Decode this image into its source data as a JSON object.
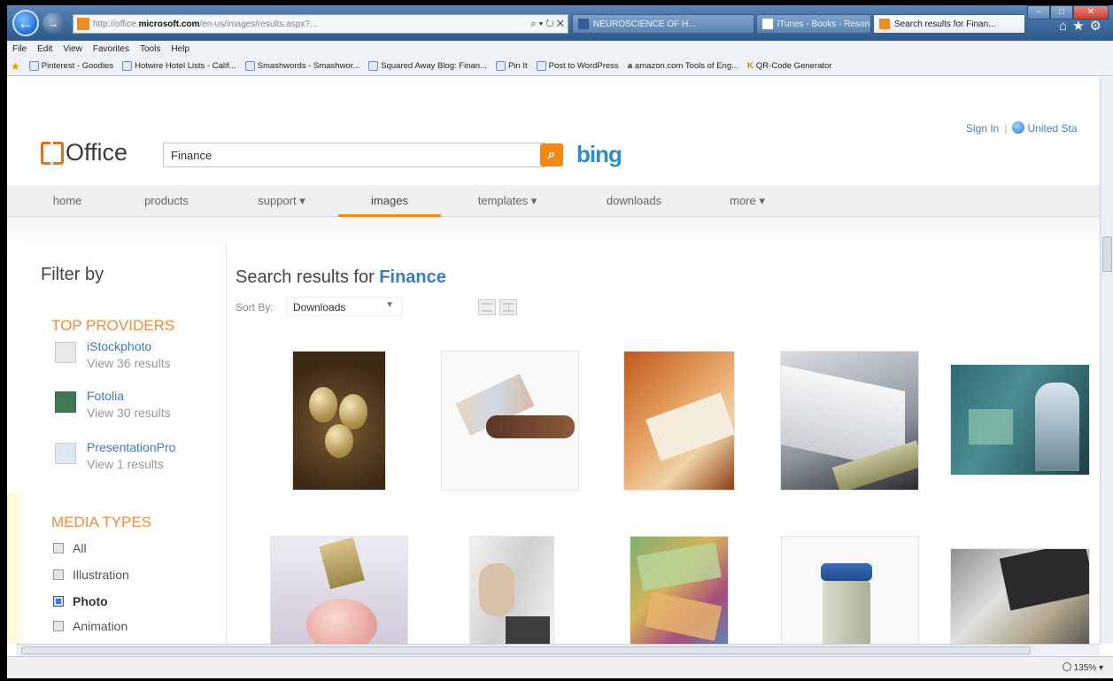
{
  "browser": {
    "address_host": "microsoft.com",
    "tabs": [
      {
        "label": "NEUROSCIENCE OF H..."
      },
      {
        "label": "iTunes - Books - Resonate..."
      },
      {
        "label": "Search results for Finan..."
      }
    ],
    "menu": [
      "File",
      "Edit",
      "View",
      "Favorites",
      "Tools",
      "Help"
    ],
    "favorites": [
      "Pinterest - Goodies",
      "Hotwire Hotel Lists - Calif...",
      "Smashwords - Smashwor...",
      "Squared Away Blog: Finan...",
      "Pin It",
      "Post to WordPress",
      "amazon.com Tools of Eng...",
      "QR-Code Generator"
    ],
    "zoom": "135%"
  },
  "header": {
    "logo": "Office",
    "search_value": "Finance",
    "bing": "bing",
    "sign_in": "Sign In",
    "region": "United Sta"
  },
  "nav": [
    {
      "label": "home"
    },
    {
      "label": "products"
    },
    {
      "label": "support ▾"
    },
    {
      "label": "images"
    },
    {
      "label": "templates ▾"
    },
    {
      "label": "downloads"
    },
    {
      "label": "more ▾"
    }
  ],
  "sidebar": {
    "title": "Filter by",
    "providers_title": "TOP PROVIDERS",
    "providers": [
      {
        "name": "iStockphoto",
        "count": "View 36 results"
      },
      {
        "name": "Fotolia",
        "count": "View 30 results"
      },
      {
        "name": "PresentationPro",
        "count": "View 1 results"
      }
    ],
    "media_title": "MEDIA TYPES",
    "media_types": [
      {
        "label": "All",
        "checked": false
      },
      {
        "label": "Illustration",
        "checked": false
      },
      {
        "label": "Photo",
        "checked": true
      },
      {
        "label": "Animation",
        "checked": false
      }
    ]
  },
  "results": {
    "title_prefix": "Search results for",
    "term": "Finance",
    "sort_label": "Sort By:",
    "sort_value": "Downloads"
  },
  "colors": {
    "accent": "#f08a17",
    "link": "#3a7ac4",
    "section": "#f08a40"
  }
}
